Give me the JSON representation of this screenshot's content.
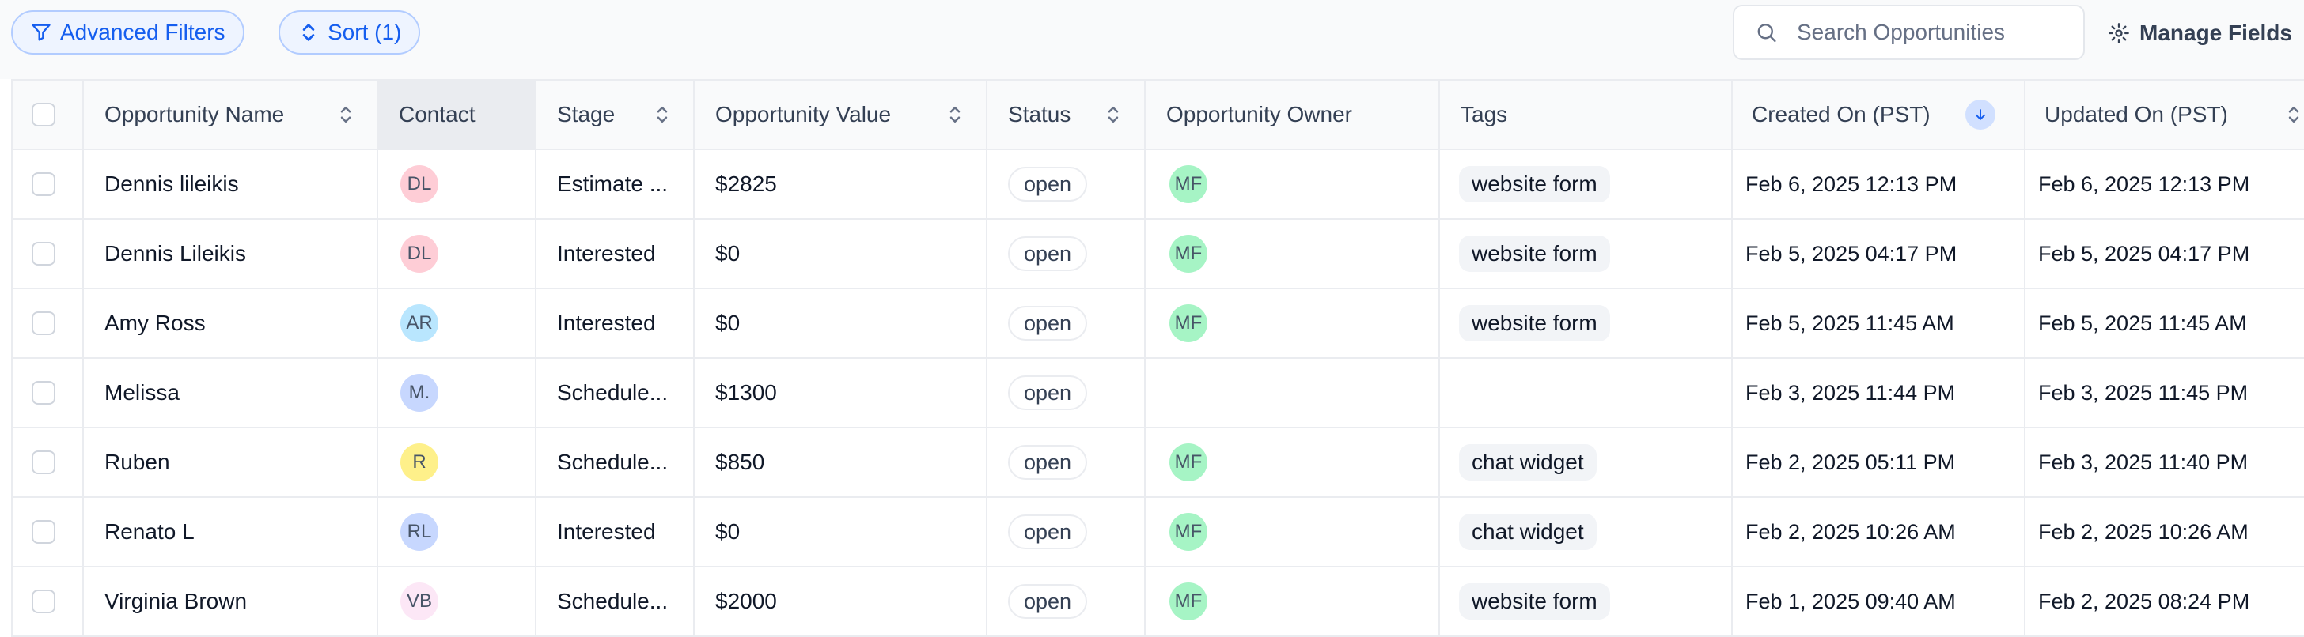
{
  "toolbar": {
    "advanced_filters_label": "Advanced Filters",
    "sort_label": "Sort (1)",
    "search_placeholder": "Search Opportunities",
    "manage_fields_label": "Manage Fields"
  },
  "columns": [
    "Opportunity Name",
    "Contact",
    "Stage",
    "Opportunity Value",
    "Status",
    "Opportunity Owner",
    "Tags",
    "Created On (PST)",
    "Updated On (PST)"
  ],
  "rows": [
    {
      "name": "Dennis lileikis",
      "contact": "DL",
      "contact_color": "#fecdd6",
      "stage": "Estimate ...",
      "value": "$2825",
      "status": "open",
      "owner": "MF",
      "tag": "website form",
      "created": "Feb 6, 2025 12:13 PM",
      "updated": "Feb 6, 2025 12:13 PM"
    },
    {
      "name": "Dennis Lileikis",
      "contact": "DL",
      "contact_color": "#fecdd6",
      "stage": "Interested",
      "value": "$0",
      "status": "open",
      "owner": "MF",
      "tag": "website form",
      "created": "Feb 5, 2025 04:17 PM",
      "updated": "Feb 5, 2025 04:17 PM"
    },
    {
      "name": "Amy Ross",
      "contact": "AR",
      "contact_color": "#b9e6fe",
      "stage": "Interested",
      "value": "$0",
      "status": "open",
      "owner": "MF",
      "tag": "website form",
      "created": "Feb 5, 2025 11:45 AM",
      "updated": "Feb 5, 2025 11:45 AM"
    },
    {
      "name": "Melissa",
      "contact": "M.",
      "contact_color": "#c7d7fe",
      "stage": "Schedule...",
      "value": "$1300",
      "status": "open",
      "owner": "",
      "tag": "",
      "created": "Feb 3, 2025 11:44 PM",
      "updated": "Feb 3, 2025 11:45 PM"
    },
    {
      "name": "Ruben",
      "contact": "R",
      "contact_color": "#fef08a",
      "stage": "Schedule...",
      "value": "$850",
      "status": "open",
      "owner": "MF",
      "tag": "chat widget",
      "created": "Feb 2, 2025 05:11 PM",
      "updated": "Feb 3, 2025 11:40 PM"
    },
    {
      "name": "Renato L",
      "contact": "RL",
      "contact_color": "#c7d7fe",
      "stage": "Interested",
      "value": "$0",
      "status": "open",
      "owner": "MF",
      "tag": "chat widget",
      "created": "Feb 2, 2025 10:26 AM",
      "updated": "Feb 2, 2025 10:26 AM"
    },
    {
      "name": "Virginia Brown",
      "contact": "VB",
      "contact_color": "#fce7f6",
      "stage": "Schedule...",
      "value": "$2000",
      "status": "open",
      "owner": "MF",
      "tag": "website form",
      "created": "Feb 1, 2025 09:40 AM",
      "updated": "Feb 2, 2025 08:24 PM"
    }
  ],
  "colors": {
    "accent": "#155eef",
    "owner_avatar": "#a6f4c5",
    "border": "#eaecf0"
  },
  "icons": {
    "filter": "filter-icon",
    "sort": "sort-icon",
    "search": "search-icon",
    "gear": "gear-icon",
    "sort_desc": "arrow-down-icon"
  }
}
